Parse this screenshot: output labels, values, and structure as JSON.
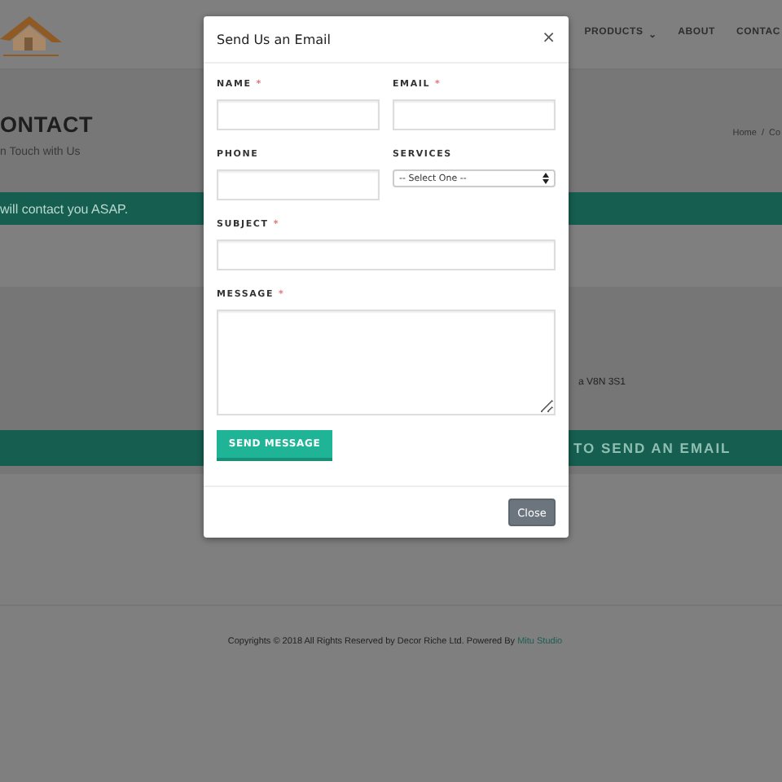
{
  "site": {
    "nav": [
      {
        "label": "PRODUCTS",
        "dropdown": true,
        "caret": "⌄"
      },
      {
        "label": "ABOUT",
        "dropdown": false
      },
      {
        "label": "CONTAC",
        "dropdown": false
      }
    ],
    "page_title": "ONTACT",
    "page_subtitle": "n Touch with Us",
    "breadcrumb": [
      "Home",
      "Co"
    ],
    "breadcrumb_separator": "/",
    "notice": "will contact you ASAP.",
    "address_fragment": "a V8N 3S1",
    "email_banner": "TO SEND AN EMAIL",
    "footer": {
      "text": "Copyrights © 2018 All Rights Reserved by Decor Riche Ltd. Powered By",
      "link": "Mitu Studio"
    }
  },
  "modal": {
    "title": "Send Us an Email",
    "close_icon": "×",
    "required_mark": "*",
    "rows": [
      [
        {
          "label": "NAME",
          "required": true,
          "kind": "text"
        },
        {
          "label": "EMAIL",
          "required": true,
          "kind": "text"
        }
      ],
      [
        {
          "label": "PHONE",
          "required": false,
          "kind": "text"
        },
        {
          "label": "SERVICES",
          "required": false,
          "kind": "select",
          "value": "-- Select One --"
        }
      ],
      [
        {
          "label": "SUBJECT",
          "required": true,
          "kind": "text"
        }
      ],
      [
        {
          "label": "MESSAGE",
          "required": true,
          "kind": "textarea"
        }
      ]
    ],
    "submit": "SEND MESSAGE",
    "close_button": "Close"
  }
}
